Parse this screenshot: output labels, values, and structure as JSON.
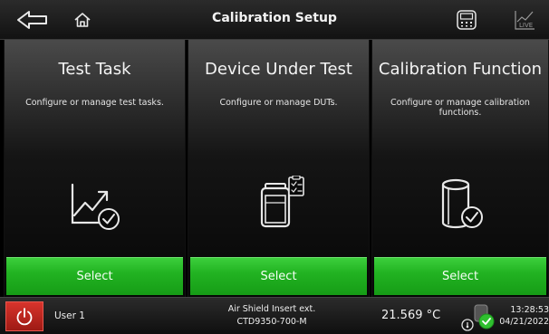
{
  "header": {
    "title": "Calibration Setup",
    "icons": [
      "back-arrow-icon",
      "home-icon",
      "calculator-icon",
      "live-chart-icon"
    ],
    "live_label": "LIVE"
  },
  "panels": [
    {
      "title": "Test Task",
      "description": "Configure or manage test tasks.",
      "icon": "chart-check-icon",
      "button": "Select"
    },
    {
      "title": "Device Under Test",
      "description": "Configure or manage DUTs.",
      "icon": "device-clipboard-icon",
      "button": "Select"
    },
    {
      "title": "Calibration Function",
      "description": "Configure or manage calibration functions.",
      "icon": "cylinder-check-icon",
      "button": "Select"
    }
  ],
  "status": {
    "user": "User 1",
    "device_line1": "Air Shield Insert ext.",
    "device_line2": "CTD9350-700-M",
    "temperature": "21.569 °C",
    "time": "13:28:53",
    "date": "04/21/2022"
  },
  "colors": {
    "accent_green": "#22b322",
    "power_red": "#c4261f",
    "ok_green": "#2fc02f"
  }
}
